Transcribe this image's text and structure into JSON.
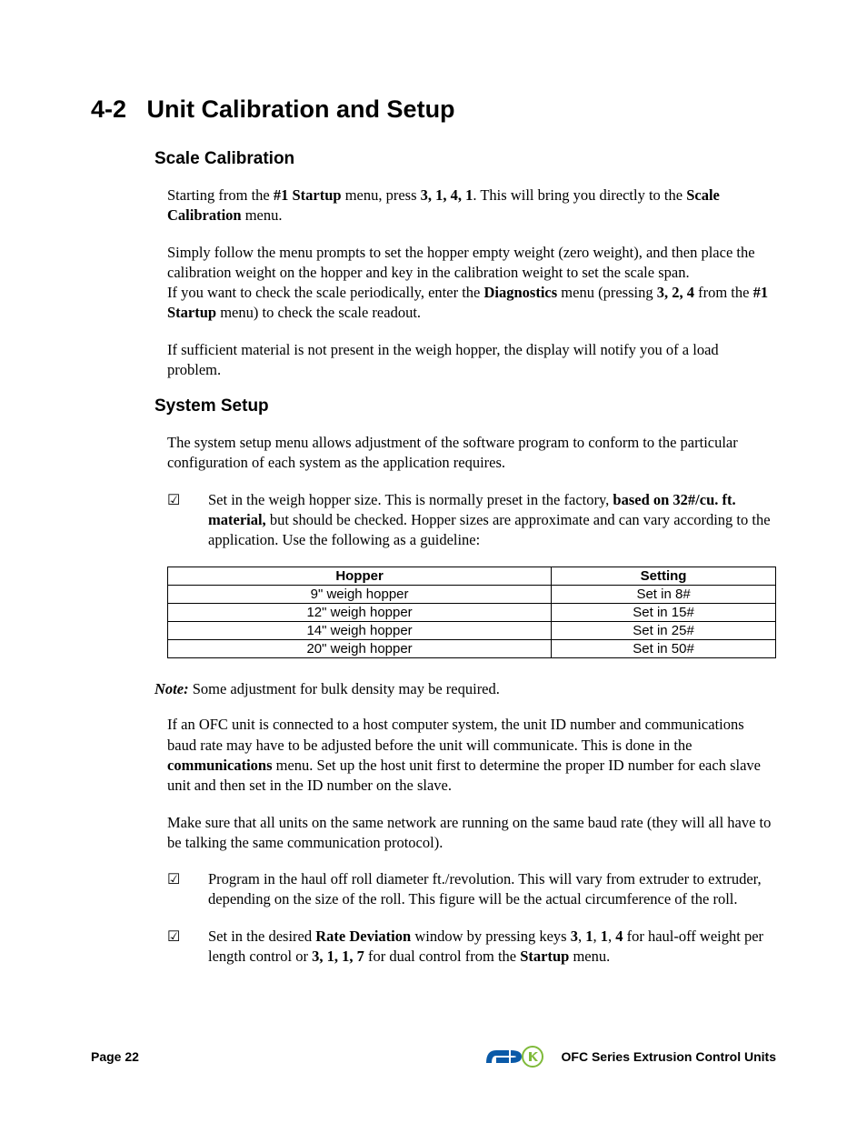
{
  "section": {
    "number": "4-2",
    "title": "Unit Calibration and Setup"
  },
  "scale_calibration": {
    "heading": "Scale Calibration",
    "p1_a": "Starting from the ",
    "p1_b": "#1 Startup",
    "p1_c": " menu, press ",
    "p1_d": "3, 1, 4, 1",
    "p1_e": ". This will bring you directly to the ",
    "p1_f": "Scale Calibration",
    "p1_g": " menu.",
    "p2": "Simply follow the menu prompts to set the hopper empty weight (zero weight), and then place the calibration weight on the hopper and key in the calibration weight to set the scale span.",
    "p3_a": "If you want to check the scale periodically, enter the ",
    "p3_b": "Diagnostics",
    "p3_c": " menu (pressing ",
    "p3_d": "3, 2, 4",
    "p3_e": " from the ",
    "p3_f": "#1 Startup",
    "p3_g": " menu) to check the scale readout.",
    "p4": "If sufficient material is not present in the weigh hopper, the display will notify you of a load problem."
  },
  "system_setup": {
    "heading": "System Setup",
    "p1": "The system setup menu allows adjustment of the software program to conform to the particular configuration of each system as the application requires.",
    "check1_a": "Set in the weigh hopper size. This is normally preset in the factory, ",
    "check1_b": "based on 32#/cu. ft. material,",
    "check1_c": " but should be checked. Hopper sizes are approximate and can vary according to the application. Use the following as a guideline:",
    "table": {
      "headers": [
        "Hopper",
        "Setting"
      ],
      "rows": [
        [
          "9\" weigh hopper",
          "Set in 8#"
        ],
        [
          "12\" weigh hopper",
          "Set in 15#"
        ],
        [
          "14\" weigh hopper",
          "Set in 25#"
        ],
        [
          "20\" weigh hopper",
          "Set in 50#"
        ]
      ]
    },
    "note_label": "Note:",
    "note_text": " Some adjustment for bulk density may be required.",
    "p2_a": "If an OFC unit is connected to a host computer system, the unit ID number and communications baud rate may have to be adjusted before the unit will communicate. This is done in the ",
    "p2_b": "communications",
    "p2_c": " menu. Set up the host unit first to determine the proper ID number for each slave unit and then set in the ID number on the slave.",
    "p3": "Make sure that all units on the same network are running on the same baud rate (they will all have to be talking the same communication protocol).",
    "check2": "Program in the haul off roll diameter ft./revolution. This will vary from extruder to extruder, depending on the size of the roll. This figure will be the actual circumference of the roll.",
    "check3_a": "Set in the desired ",
    "check3_b": "Rate Deviation",
    "check3_c": " window by pressing keys ",
    "check3_d": "3",
    "check3_e": ", ",
    "check3_f": "1",
    "check3_g": ", ",
    "check3_h": "1",
    "check3_i": ", ",
    "check3_j": "4",
    "check3_k": " for haul-off weight per length control or ",
    "check3_l": "3, 1, 1, 7",
    "check3_m": " for dual control from the ",
    "check3_n": "Startup",
    "check3_o": " menu."
  },
  "footer": {
    "page_label": "Page 22",
    "product": "OFC Series Extrusion Control Units"
  },
  "icons": {
    "checkbox": "☑"
  }
}
